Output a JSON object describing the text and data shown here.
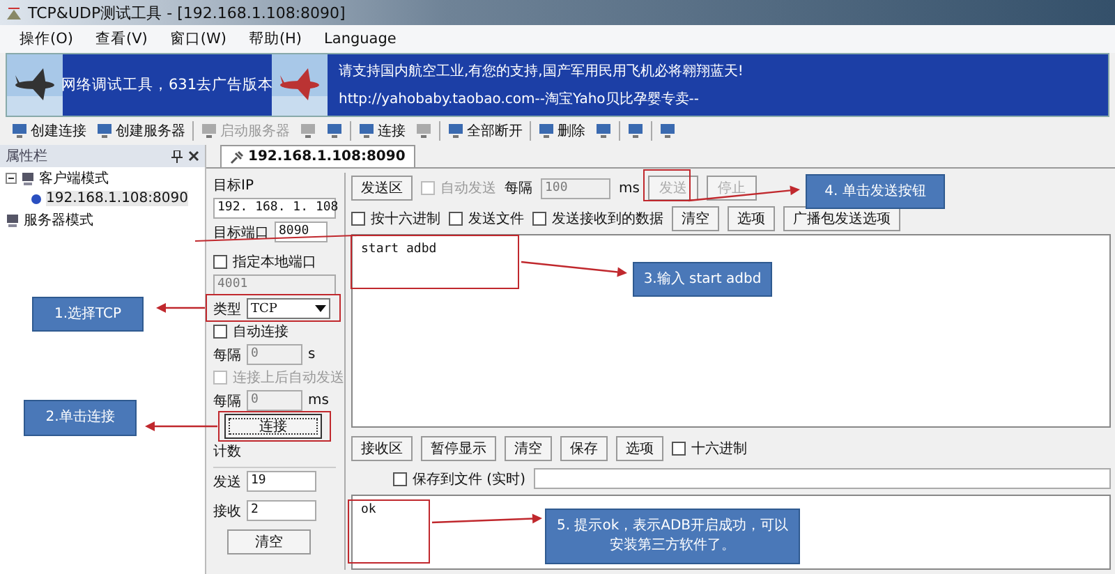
{
  "window": {
    "title": "TCP&UDP测试工具 - [192.168.1.108:8090]"
  },
  "menu": [
    "操作(O)",
    "查看(V)",
    "窗口(W)",
    "帮助(H)",
    "Language"
  ],
  "banner": {
    "left_text": "网络调试工具，631去广告版本",
    "right_lines": [
      "请支持国内航空工业,有您的支持,国产军用民用飞机必将翱翔蓝天!",
      "http://yahobaby.taobao.com--淘宝Yaho贝比孕婴专卖--"
    ]
  },
  "toolbar": [
    {
      "kind": "button",
      "label": "创建连接",
      "disabled": false
    },
    {
      "kind": "button",
      "label": "创建服务器",
      "disabled": false
    },
    {
      "kind": "separator"
    },
    {
      "kind": "button",
      "label": "启动服务器",
      "disabled": true
    },
    {
      "kind": "icon",
      "disabled": true
    },
    {
      "kind": "icon",
      "disabled": false
    },
    {
      "kind": "separator"
    },
    {
      "kind": "button",
      "label": "连接",
      "disabled": false
    },
    {
      "kind": "icon",
      "disabled": true
    },
    {
      "kind": "separator"
    },
    {
      "kind": "button",
      "label": "全部断开",
      "disabled": false
    },
    {
      "kind": "separator"
    },
    {
      "kind": "button",
      "label": "删除",
      "disabled": false
    },
    {
      "kind": "icon",
      "disabled": false
    },
    {
      "kind": "separator"
    },
    {
      "kind": "icon",
      "disabled": false
    },
    {
      "kind": "separator"
    },
    {
      "kind": "icon",
      "disabled": false
    }
  ],
  "sidebar": {
    "title": "属性栏",
    "tree": [
      {
        "label": "客户端模式",
        "selected": false,
        "expanded": true,
        "children": [
          {
            "label": "192.168.1.108:8090",
            "selected": true
          }
        ]
      },
      {
        "label": "服务器模式",
        "selected": false
      }
    ]
  },
  "tab": {
    "label": "192.168.1.108:8090",
    "selected": true
  },
  "connection": {
    "target_ip_label": "目标IP",
    "target_ip": "192. 168. 1. 108",
    "target_port_label": "目标端口",
    "target_port": "8090",
    "local_port": {
      "label": "指定本地端口",
      "checked": false,
      "value": "4001"
    },
    "type_label": "类型",
    "type": "TCP",
    "auto_connect": {
      "label": "自动连接",
      "checked": false,
      "interval_label": "每隔",
      "interval": "0",
      "unit": "s"
    },
    "auto_send": {
      "label": "连接上后自动发送",
      "checked": false,
      "disabled": true,
      "interval_label": "每隔",
      "interval": "0",
      "unit": "ms"
    },
    "connect_button": "连接",
    "counter": {
      "title": "计数",
      "sent_label": "发送",
      "sent": "19",
      "received_label": "接收",
      "received": "2",
      "clear_button": "清空"
    }
  },
  "send": {
    "area_label": "发送区",
    "auto_send": {
      "label": "自动发送",
      "checked": false,
      "disabled": true
    },
    "interval_label": "每隔",
    "interval": "100",
    "unit": "ms",
    "buttons": [
      {
        "label": "发送",
        "disabled": true
      },
      {
        "label": "停止",
        "disabled": true
      }
    ],
    "options": [
      {
        "label": "按十六进制",
        "checked": false
      },
      {
        "label": "发送文件",
        "checked": false
      },
      {
        "label": "发送接收到的数据",
        "checked": false
      }
    ],
    "option_buttons": [
      "清空",
      "选项",
      "广播包发送选项"
    ],
    "content": "start adbd"
  },
  "receive": {
    "area_label": "接收区",
    "buttons": [
      "暂停显示",
      "清空",
      "保存",
      "选项"
    ],
    "hex": {
      "label": "十六进制",
      "checked": false
    },
    "save_to_file": {
      "label": "保存到文件 (实时)",
      "checked": false
    },
    "content": "ok"
  },
  "callouts": [
    "1.选择TCP",
    "2.单击连接",
    "3.输入 start adbd",
    "4. 单击发送按钮",
    "5. 提示ok，表示ADB开启成功，可以安装第三方软件了。"
  ]
}
